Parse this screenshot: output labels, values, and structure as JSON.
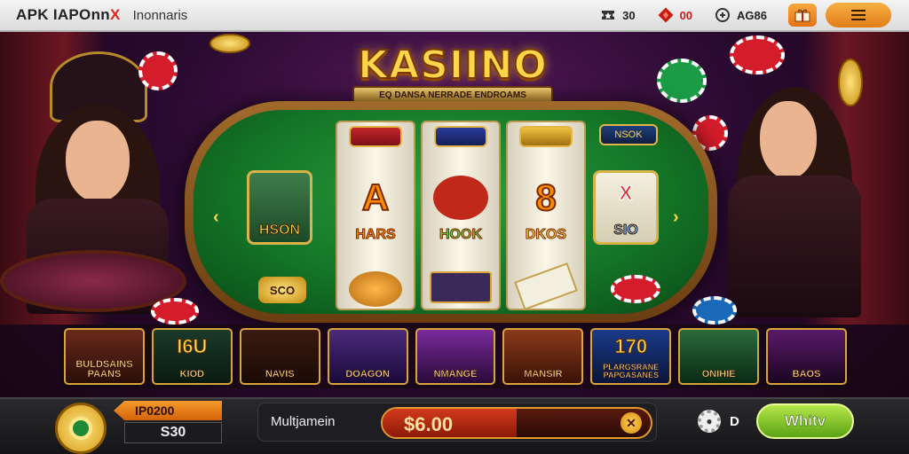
{
  "topbar": {
    "brand_main": "APK IAPOnn",
    "brand_accent": "X",
    "subtitle": "Inonnaris",
    "stats": [
      {
        "icon": "ticket-icon",
        "value": "30"
      },
      {
        "icon": "gem-icon",
        "value": "00"
      },
      {
        "icon": "coin-icon",
        "value": "AG86"
      }
    ]
  },
  "logo": {
    "title": "KASIINO",
    "tagline": "EQ DANSA NERRADE ENDROAMS"
  },
  "reels": [
    {
      "badge": "",
      "symbol": "",
      "label": "HSON"
    },
    {
      "badge": "",
      "symbol": "A",
      "label": "HARS"
    },
    {
      "badge": "",
      "symbol": "",
      "label": "HOOK"
    },
    {
      "badge": "",
      "symbol": "8",
      "label": "DKOS"
    },
    {
      "badge": "NSOK",
      "symbol": "X",
      "label": "SIO"
    }
  ],
  "reel_extras": {
    "coin_label": "SCO"
  },
  "games": [
    {
      "title": "BULDSAINS PAANS",
      "big": ""
    },
    {
      "title": "KIOD",
      "big": "I6U"
    },
    {
      "title": "NAVIS",
      "big": ""
    },
    {
      "title": "DOAGON",
      "big": ""
    },
    {
      "title": "NMANGE",
      "big": ""
    },
    {
      "title": "MANSIR",
      "big": ""
    },
    {
      "title": "PLARGSRANE PAPGASANES",
      "big": "170"
    },
    {
      "title": "ONIHIE",
      "big": ""
    },
    {
      "title": "BAOS",
      "big": ""
    }
  ],
  "bottom": {
    "bet_tag": "IP0200",
    "bet_value": "S30",
    "mult_label": "Multjamein",
    "mult_value": "$6.00",
    "mult_fill": 0.5,
    "settings_value": "D",
    "play_label": "Whitv"
  }
}
